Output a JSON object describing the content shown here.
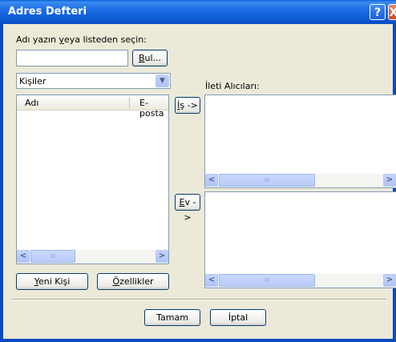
{
  "window": {
    "title": "Adres Defteri",
    "help_button": "?",
    "close_button": "X"
  },
  "search": {
    "prompt_prefix": "Adı yazın ",
    "prompt_u": "y",
    "prompt_suffix": "eya listeden seçin:",
    "value": "",
    "find_button_u": "B",
    "find_button_rest": "ul..."
  },
  "source_combo": {
    "selected": "Kişiler"
  },
  "contacts_list": {
    "columns": [
      "Adı",
      "E-posta"
    ],
    "rows": []
  },
  "recipients_label": "İleti Alıcıları:",
  "work_button": {
    "u": "İ",
    "rest": "ş ->"
  },
  "home_button": {
    "u": "E",
    "rest": "v ->"
  },
  "new_contact_button": {
    "u": "Y",
    "rest": "eni Kişi"
  },
  "properties_button": {
    "u": "Ö",
    "rest": "zellikler"
  },
  "ok_button": "Tamam",
  "cancel_button": "İptal"
}
